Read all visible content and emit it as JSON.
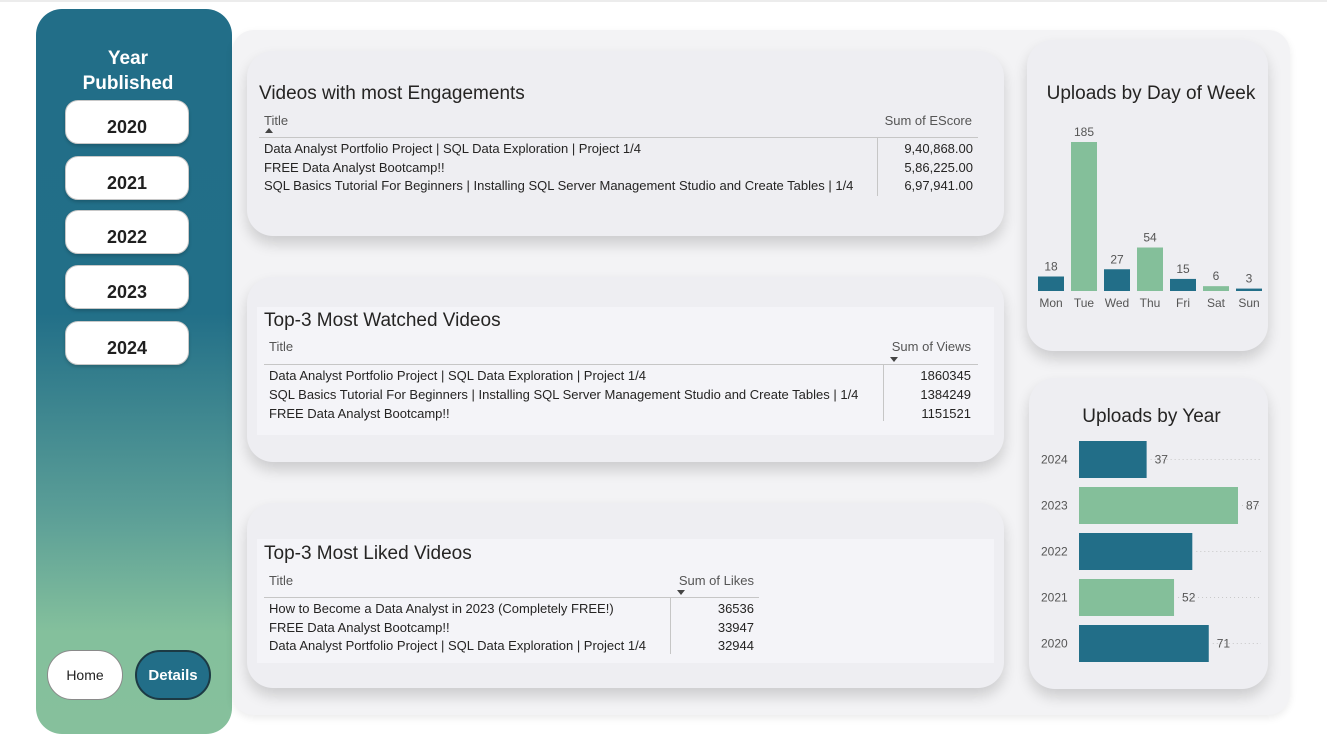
{
  "sidebar": {
    "title_line1": "Year",
    "title_line2": "Published",
    "years": [
      "2020",
      "2021",
      "2022",
      "2023",
      "2024"
    ],
    "home_label": "Home",
    "details_label": "Details"
  },
  "engagements": {
    "title": "Videos with most Engagements",
    "col_title": "Title",
    "col_value": "Sum of EScore",
    "rows": [
      {
        "title": "Data Analyst Portfolio Project | SQL Data Exploration | Project 1/4",
        "value": "9,40,868.00"
      },
      {
        "title": "FREE Data Analyst Bootcamp!!",
        "value": "5,86,225.00"
      },
      {
        "title": "SQL Basics Tutorial For Beginners | Installing SQL Server Management Studio and Create Tables | 1/4",
        "value": "6,97,941.00"
      }
    ]
  },
  "watched": {
    "title": "Top-3 Most Watched Videos",
    "col_title": "Title",
    "col_value": "Sum of Views",
    "rows": [
      {
        "title": "Data Analyst Portfolio Project | SQL Data Exploration | Project 1/4",
        "value": "1860345"
      },
      {
        "title": "SQL Basics Tutorial For Beginners | Installing SQL Server Management Studio and Create Tables | 1/4",
        "value": "1384249"
      },
      {
        "title": "FREE Data Analyst Bootcamp!!",
        "value": "1151521"
      }
    ]
  },
  "liked": {
    "title": "Top-3 Most Liked Videos",
    "col_title": "Title",
    "col_value": "Sum of Likes",
    "rows": [
      {
        "title": "How to Become a Data Analyst in 2023 (Completely FREE!)",
        "value": "36536"
      },
      {
        "title": "FREE Data Analyst Bootcamp!!",
        "value": "33947"
      },
      {
        "title": "Data Analyst Portfolio Project | SQL Data Exploration | Project 1/4",
        "value": "32944"
      }
    ]
  },
  "colors": {
    "teal": "#226e88",
    "green": "#84bf9a"
  },
  "chart_data": [
    {
      "type": "bar",
      "title": "Uploads by Day of Week",
      "categories": [
        "Mon",
        "Tue",
        "Wed",
        "Thu",
        "Fri",
        "Sat",
        "Sun"
      ],
      "values": [
        18,
        185,
        27,
        54,
        15,
        6,
        3
      ],
      "bar_colors": [
        "#226e88",
        "#84bf9a",
        "#226e88",
        "#84bf9a",
        "#226e88",
        "#84bf9a",
        "#226e88"
      ],
      "ylim": [
        0,
        185
      ],
      "grid": false
    },
    {
      "type": "bar",
      "orientation": "horizontal",
      "title": "Uploads by Year",
      "categories": [
        "2024",
        "2023",
        "2022",
        "2021",
        "2020"
      ],
      "values": [
        37,
        87,
        null,
        52,
        71
      ],
      "bar_values_estimated": [
        37,
        87,
        62,
        52,
        71
      ],
      "labels": [
        "37",
        "87",
        "",
        "52",
        "71"
      ],
      "bar_colors": [
        "#226e88",
        "#84bf9a",
        "#226e88",
        "#84bf9a",
        "#226e88"
      ],
      "xlim": [
        0,
        87
      ],
      "grid": false
    }
  ]
}
